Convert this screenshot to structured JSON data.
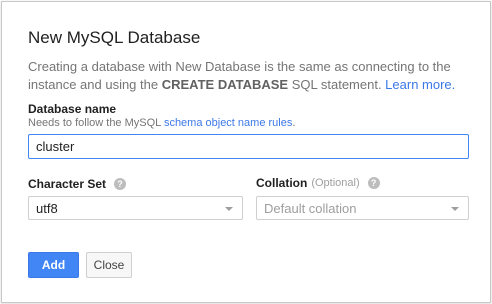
{
  "dialog": {
    "title": "New MySQL Database",
    "description": {
      "part1": "Creating a database with New Database is the same as connecting to the instance and using the ",
      "bold": "CREATE DATABASE",
      "part2": " SQL statement. ",
      "link": "Learn more."
    },
    "database_name": {
      "label": "Database name",
      "hint_prefix": "Needs to follow the MySQL ",
      "hint_link": "schema object name rules",
      "hint_suffix": ".",
      "value": "cluster"
    },
    "character_set": {
      "label": "Character Set",
      "help_icon": "?",
      "selected": "utf8"
    },
    "collation": {
      "label": "Collation",
      "optional": "(Optional)",
      "help_icon": "?",
      "placeholder": "Default collation"
    },
    "buttons": {
      "add": "Add",
      "close": "Close"
    }
  },
  "colors": {
    "accent": "#4285f4",
    "link": "#3b78e7"
  }
}
